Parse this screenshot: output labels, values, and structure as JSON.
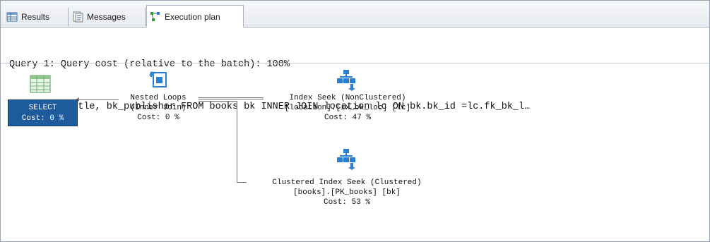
{
  "tabs": [
    {
      "label": "Results",
      "icon": "grid-icon"
    },
    {
      "label": "Messages",
      "icon": "messages-icon"
    },
    {
      "label": "Execution plan",
      "icon": "execution-plan-icon"
    }
  ],
  "header": {
    "query_line": "Query 1: Query cost (relative to the batch): 100%",
    "sql_line": "SELECT bk_title, bk_publisher FROM books bk INNER JOIN location lc ON bk.bk_id =lc.fk_bk_l…"
  },
  "nodes": {
    "select": {
      "label": "SELECT",
      "cost": "Cost: 0 %",
      "icon": "result-grid-icon"
    },
    "nested_loops": {
      "line1": "Nested Loops",
      "line2": "(Inner Join)",
      "cost": "Cost: 0 %",
      "icon": "nested-loops-icon"
    },
    "index_seek": {
      "line1": "Index Seek (NonClustered)",
      "line2": "[location].[ix_bk_loc] [lc]",
      "cost": "Cost: 47 %",
      "icon": "index-seek-icon"
    },
    "clustered_seek": {
      "line1": "Clustered Index Seek (Clustered)",
      "line2": "[books].[PK_books] [bk]",
      "cost": "Cost: 53 %",
      "icon": "clustered-index-seek-icon"
    }
  },
  "colors": {
    "select_bg": "#1e5b9c",
    "icon_blue": "#2a7fd1"
  }
}
